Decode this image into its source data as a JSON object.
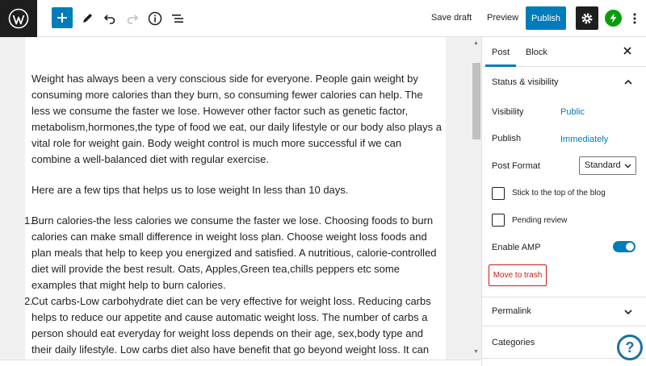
{
  "toolbar": {
    "save_draft": "Save draft",
    "preview": "Preview",
    "publish": "Publish"
  },
  "content": {
    "paragraph1": "Weight has always been a very conscious side for everyone. People gain weight by consuming more calories than they burn, so consuming fewer calories can help. The less we consume the faster we lose. However other factor such as genetic factor, metabolism,hormones,the type of food we eat, our daily lifestyle or our body also plays a vital role for weight gain. Body weight control is much more successful if we can combine a well-balanced diet with regular exercise.",
    "paragraph2": "Here are a few tips that helps us to lose weight In less than 10 days.",
    "list": [
      {
        "num": "1.",
        "text": "Burn calories-the less calories we consume the faster we lose. Choosing foods to burn calories can make small difference in weight loss plan. Choose weight loss foods and plan meals that help to keep you energized and satisfied. A nutritious, calorie-controlled diet will provide the best result. Oats, Apples,Green tea,chills peppers etc some examples that might help to burn calories."
      },
      {
        "num": "2.",
        "text": "Cut carbs-Low carbohydrate diet can be very effective for weight loss. Reducing carbs helps to reduce our appetite and cause automatic weight loss. The number of carbs a person should eat everyday for weight loss depends on their age, sex,body type and their daily lifestyle. Low carbs diet also have benefit that go beyond weight loss. It can help to"
      }
    ]
  },
  "sidebar": {
    "tab_post": "Post",
    "tab_block": "Block",
    "status_title": "Status & visibility",
    "visibility_label": "Visibility",
    "visibility_value": "Public",
    "publish_label": "Publish",
    "publish_value": "Immediately",
    "format_label": "Post Format",
    "format_value": "Standard",
    "stick_label": "Stick to the top of the blog",
    "pending_label": "Pending review",
    "amp_label": "Enable AMP",
    "amp_enabled": true,
    "trash_label": "Move to trash",
    "permalink_title": "Permalink",
    "categories_title": "Categories"
  },
  "colors": {
    "accent": "#007cba",
    "danger": "#cc1818",
    "jetpack": "#069e08"
  }
}
